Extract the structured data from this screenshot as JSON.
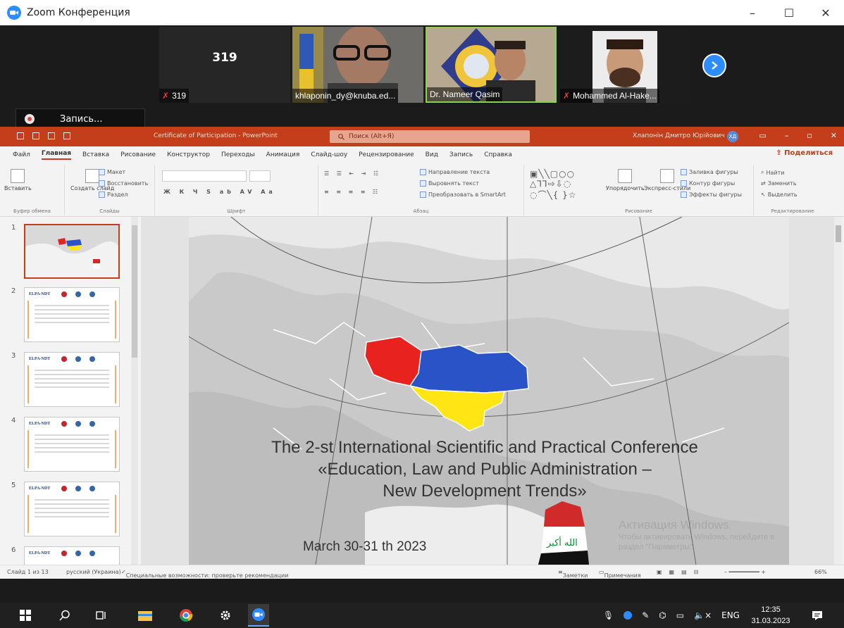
{
  "zoom": {
    "window_title": "Zoom Конференция",
    "window_buttons": [
      "–",
      "☐",
      "✕"
    ],
    "participants": [
      {
        "name": "319",
        "label": "319",
        "muted": true
      },
      {
        "label": "khlaponin_dy@knuba.ed...",
        "muted": false
      },
      {
        "label": "Dr. Nameer Qasim",
        "muted": false
      },
      {
        "label": "Mohammed Al-Hake...",
        "muted": true
      }
    ],
    "recording_label": "Запись..."
  },
  "ppt": {
    "doc_title": "Certificate of Participation - PowerPoint",
    "search_placeholder": "Поиск (Alt+Я)",
    "user_name": "Хлапонін Дмитро Юрійович",
    "user_initials": "ХД",
    "tabs": [
      "Файл",
      "Главная",
      "Вставка",
      "Рисование",
      "Конструктор",
      "Переходы",
      "Анимация",
      "Слайд-шоу",
      "Рецензирование",
      "Вид",
      "Запись",
      "Справка"
    ],
    "active_tab": "Главная",
    "share_label": "Поделиться",
    "ribbon": {
      "paste": "Вставить",
      "new_slide": "Создать слайд",
      "layout": "Макет",
      "reset": "Восстановить",
      "section": "Раздел",
      "text_direction": "Направление текста",
      "align_text": "Выровнять текст",
      "smartart": "Преобразовать в SmartArt",
      "arrange": "Упорядочить",
      "quick_styles": "Экспресс-стили",
      "shape_fill": "Заливка фигуры",
      "shape_outline": "Контур фигуры",
      "shape_effects": "Эффекты фигуры",
      "find": "Найти",
      "replace": "Заменить",
      "select": "Выделить",
      "groups": {
        "clipboard": "Буфер обмена",
        "slides": "Слайды",
        "font": "Шрифт",
        "paragraph": "Абзац",
        "drawing": "Рисование",
        "editing": "Редактирование"
      }
    },
    "thumbnails": [
      {
        "num": "1"
      },
      {
        "num": "2",
        "head": "ELPA-NDT"
      },
      {
        "num": "3",
        "head": "ELPA-NDT"
      },
      {
        "num": "4",
        "head": "ELPA-NDT"
      },
      {
        "num": "5",
        "head": "ELPA-NDT"
      },
      {
        "num": "6",
        "head": "ELPA-NDT"
      }
    ],
    "slide": {
      "title_line1": "The 2-st International Scientific and Practical Conference",
      "title_line2": "«Education, Law and Public Administration –",
      "title_line3": "New Development Trends»",
      "date": "March 30-31 th 2023",
      "flag_text": "الله أكبر",
      "watermark_line1": "Активация Windows",
      "watermark_line2": "Чтобы активировать Windows, перейдите в раздел \"Параметры\"."
    },
    "status": {
      "slide_count": "Слайд 1 из 13",
      "language": "русский (Украина)",
      "accessibility": "Специальные возможности: проверьте рекомендации",
      "notes": "Заметки",
      "comments": "Примечания",
      "zoom": "66%"
    }
  },
  "taskbar": {
    "time": "12:35",
    "date": "31.03.2023",
    "lang": "ENG"
  },
  "colors": {
    "zoom_blue": "#2d8cff",
    "ppt_red": "#c43e1c",
    "flag_blue": "#2a53c8",
    "flag_yellow": "#ffe514",
    "poland_red": "#e8221f"
  }
}
